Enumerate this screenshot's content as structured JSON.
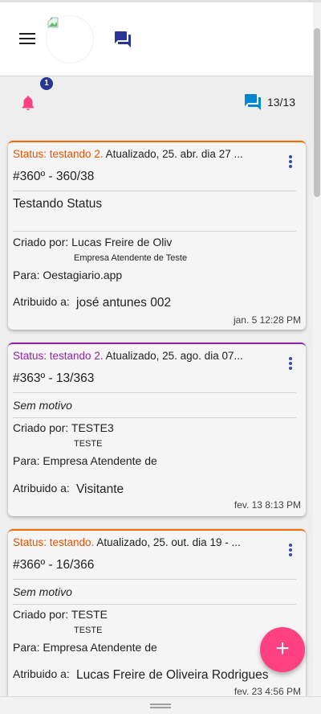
{
  "header": {
    "menu_icon": "menu-icon",
    "logo": "broken-image-icon",
    "chat_icon": "chat-icon"
  },
  "subbar": {
    "notifications_badge": "1",
    "chat_count": "13/13"
  },
  "cards": [
    {
      "status": "Status: testando 2.",
      "status_color": "#e65100",
      "border_color": "#ef6c00",
      "updated": "Atualizado, 25. abr. dia 27 ...",
      "code": "#360º - 360/38",
      "title": "Testando Status",
      "created_label": "Criado por:",
      "created_by": "Lucas Freire de Oliv",
      "company": "Empresa Atendente de Teste",
      "for_label": "Para:",
      "for_value": "Oestagiario.app",
      "assigned_label": "Atribuido a:",
      "assigned_to": "josé antunes 002",
      "date": "jan. 5 12:28 PM"
    },
    {
      "status": "Status: testando 2.",
      "status_color": "#8e24aa",
      "border_color": "#8e24aa",
      "updated": "Atualizado, 25. ago. dia 07...",
      "code": "#363º - 13/363",
      "title": "Sem motivo",
      "created_label": "Criado por:",
      "created_by": "TESTE3",
      "company": "TESTE",
      "for_label": "Para:",
      "for_value": "Empresa Atendente de",
      "assigned_label": "Atribuido a:",
      "assigned_to": "Visitante",
      "date": "fev. 13 8:13 PM"
    },
    {
      "status": "Status: testando.",
      "status_color": "#e65100",
      "border_color": "#ef6c00",
      "updated": "Atualizado, 25. out. dia 19 - ...",
      "code": "#366º - 16/366",
      "title": "Sem motivo",
      "created_label": "Criado por:",
      "created_by": "TESTE",
      "company": "TESTE",
      "for_label": "Para:",
      "for_value": "Empresa Atendente de",
      "assigned_label": "Atribuido a:",
      "assigned_to": "Lucas Freire de Oliveira Rodrigues",
      "date": "fev. 23 4:56 PM"
    }
  ],
  "fab": {
    "label": "+"
  }
}
